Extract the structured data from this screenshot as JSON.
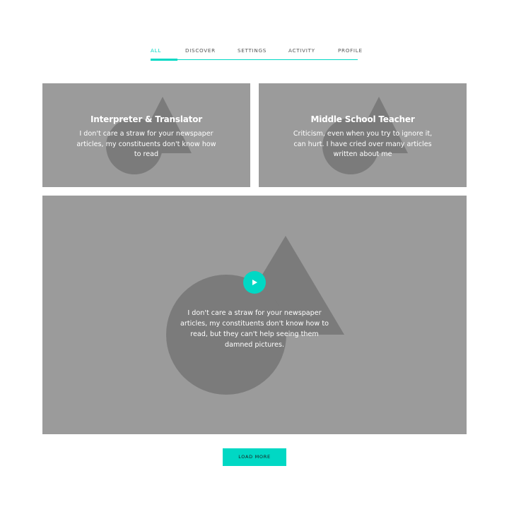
{
  "tabs": [
    {
      "label": "ALL",
      "active": true
    },
    {
      "label": "DISCOVER",
      "active": false
    },
    {
      "label": "SETTINGS",
      "active": false
    },
    {
      "label": "ACTIVITY",
      "active": false
    },
    {
      "label": "PROFILE",
      "active": false
    }
  ],
  "cards": [
    {
      "title": "Interpreter & Translator",
      "description": "I don't care a straw for your newspaper articles, my constituents don't know how to read"
    },
    {
      "title": "Middle School Teacher",
      "description": "Criticism, even when you try to ignore it, can hurt. I have cried over many articles written about me"
    }
  ],
  "featured": {
    "description": "I don't care a straw for your newspaper articles, my constituents don't know how to read, but they can't help seeing them damned pictures.",
    "play_icon": "play-icon"
  },
  "load_more_label": "LOAD MORE",
  "colors": {
    "accent": "#00d8c4",
    "card_bg": "#9b9b9b",
    "shape": "#7b7b7b"
  }
}
